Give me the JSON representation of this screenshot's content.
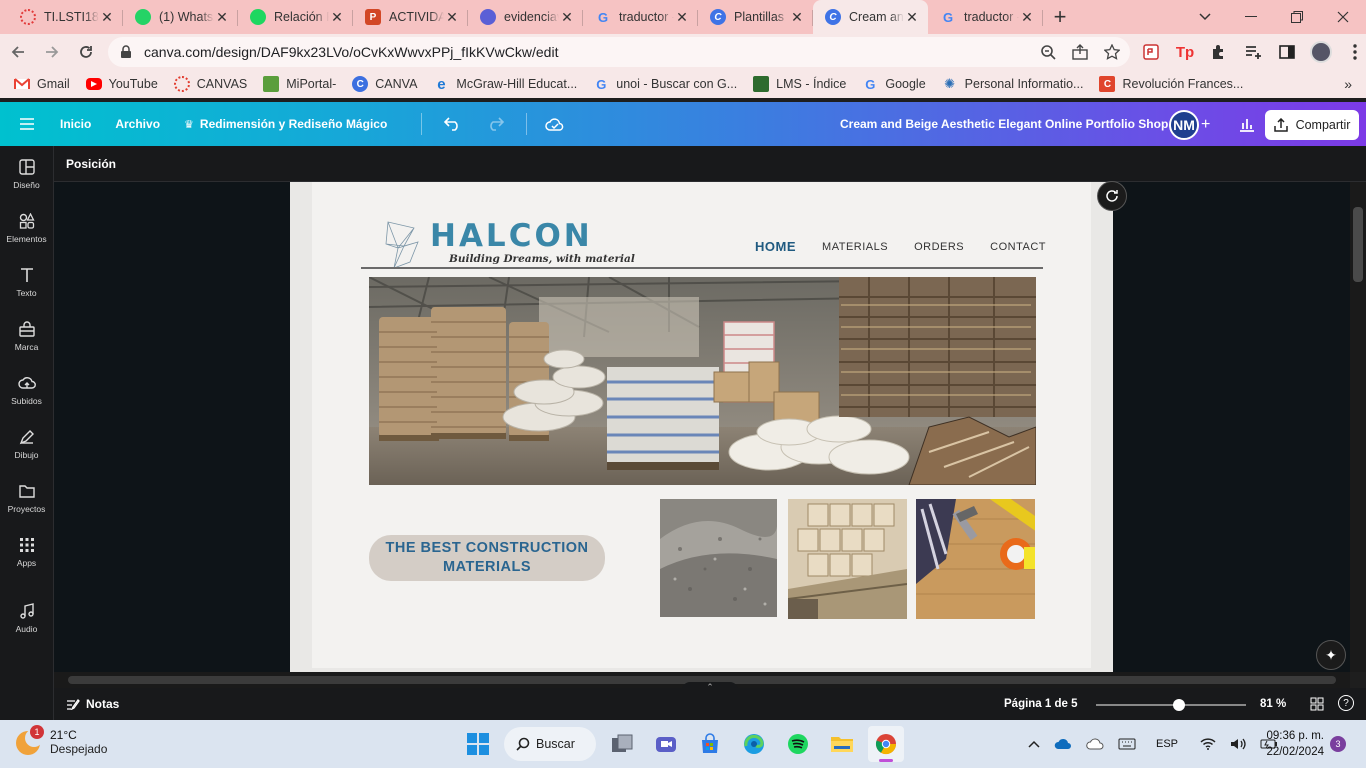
{
  "browser": {
    "tabs": [
      {
        "title": "TI.LSTI183",
        "icon": "ring-red-icon"
      },
      {
        "title": "(1) WhatsA",
        "icon": "whatsapp-icon"
      },
      {
        "title": "Relación R",
        "icon": "spotify-icon"
      },
      {
        "title": "ACTIVIDAD",
        "icon": "powerpoint-icon"
      },
      {
        "title": "evidenciav",
        "icon": "heart-shield-icon"
      },
      {
        "title": "traductor -",
        "icon": "google-icon"
      },
      {
        "title": "Plantillas",
        "icon": "canva-icon"
      },
      {
        "title": "Cream and",
        "icon": "canva-icon"
      },
      {
        "title": "traductor -",
        "icon": "google-icon"
      }
    ],
    "active_tab_index": 7,
    "url": "canva.com/design/DAF9kx23LVo/oCvKxWwvxPPj_fIkKVwCkw/edit",
    "bookmarks": [
      {
        "label": "Gmail",
        "icon": "gmail-icon",
        "color": "#ea4335"
      },
      {
        "label": "YouTube",
        "icon": "youtube-icon",
        "color": "#ff0000"
      },
      {
        "label": "CANVAS",
        "icon": "canvas-ring-icon",
        "color": "#e13c2f"
      },
      {
        "label": "MiPortal-",
        "icon": "miportal-icon",
        "color": "#5b9e3c"
      },
      {
        "label": "CANVA",
        "icon": "canva-icon",
        "color": "#3c6fe0"
      },
      {
        "label": "McGraw-Hill Educat...",
        "icon": "edge-e-icon",
        "color": "#1f7ad6"
      },
      {
        "label": "unoi - Buscar con G...",
        "icon": "google-icon",
        "color": "#4285f4"
      },
      {
        "label": "LMS - Índice",
        "icon": "lms-icon",
        "color": "#2e6b2e"
      },
      {
        "label": "Google",
        "icon": "google-icon",
        "color": "#4285f4"
      },
      {
        "label": "Personal Informatio...",
        "icon": "lightbulb-icon",
        "color": "#2a6db5"
      },
      {
        "label": "Revolución Frances...",
        "icon": "c-red-icon",
        "color": "#e0452c"
      }
    ]
  },
  "canva": {
    "menu": [
      "Inicio",
      "Archivo"
    ],
    "magic_label": "Redimensión y Rediseño Mágico",
    "doc_title": "Cream and Beige Aesthetic Elegant Online Portfolio Shop D...",
    "avatar_initials": "NM",
    "share_label": "Compartir",
    "context_label": "Posición",
    "sidebar": [
      {
        "label": "Diseño",
        "icon": "layout-icon"
      },
      {
        "label": "Elementos",
        "icon": "shapes-icon"
      },
      {
        "label": "Texto",
        "icon": "text-icon"
      },
      {
        "label": "Marca",
        "icon": "brand-bag-icon"
      },
      {
        "label": "Subidos",
        "icon": "cloud-upload-icon"
      },
      {
        "label": "Dibujo",
        "icon": "pen-icon"
      },
      {
        "label": "Proyectos",
        "icon": "folder-icon"
      },
      {
        "label": "Apps",
        "icon": "apps-grid-icon"
      },
      {
        "label": "Audio",
        "icon": "music-note-icon"
      }
    ],
    "footer": {
      "notes_label": "Notas",
      "page_label": "Página 1 de 5",
      "zoom_label": "81 %",
      "zoom_fraction": 0.55
    }
  },
  "design": {
    "brand": "HALCON",
    "tagline": "Building Dreams, with material",
    "nav": [
      "HOME",
      "MATERIALS",
      "ORDERS",
      "CONTACT"
    ],
    "headline_line1": "THE BEST CONSTRUCTION",
    "headline_line2": "MATERIALS",
    "brand_color": "#3a87a8",
    "accent_color": "#1f5a80"
  },
  "taskbar": {
    "temperature": "21°C",
    "condition": "Despejado",
    "weather_badge": "1",
    "search_label": "Buscar",
    "language": "ESP",
    "time": "09:36 p. m.",
    "date": "22/02/2024",
    "notifications": "3"
  }
}
